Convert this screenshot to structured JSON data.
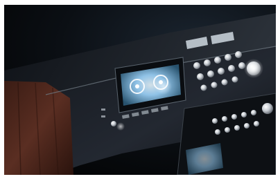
{
  "image": {
    "kind": "photograph",
    "subject": "cassette-deck",
    "palette": {
      "background": "#07090c",
      "panel": "#1a1d22",
      "chrome": "#c7ccd2",
      "wood": "#5a2e22",
      "glow": "#9fd7ff"
    }
  }
}
